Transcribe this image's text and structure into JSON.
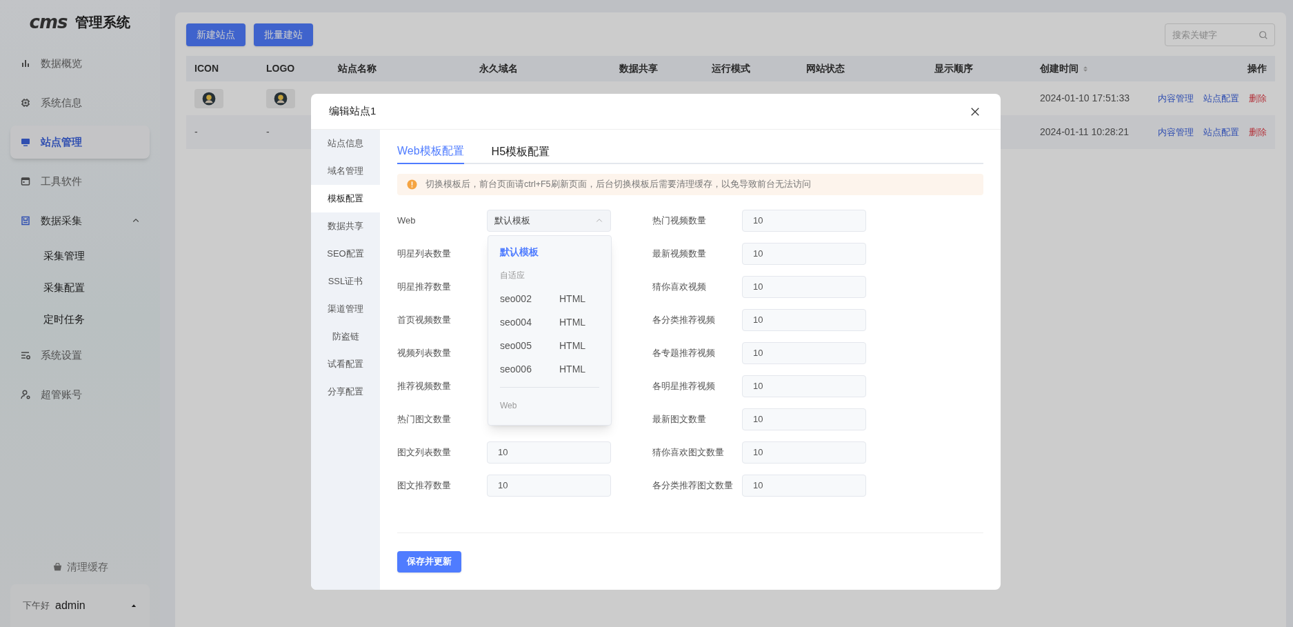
{
  "sidebar": {
    "logo": "cms",
    "title": "管理系统",
    "items": [
      {
        "label": "数据概览",
        "selected": false
      },
      {
        "label": "系统信息",
        "selected": false
      },
      {
        "label": "站点管理",
        "selected": true
      },
      {
        "label": "工具软件",
        "selected": false
      },
      {
        "label": "数据采集",
        "selected": false,
        "expanded": true,
        "children": [
          {
            "label": "采集管理",
            "selected": false
          },
          {
            "label": "采集配置",
            "selected": false
          },
          {
            "label": "定时任务",
            "selected": false
          }
        ]
      },
      {
        "label": "系统设置",
        "selected": false
      },
      {
        "label": "超管账号",
        "selected": false
      }
    ],
    "clear_cache": "清理缓存",
    "user": {
      "greeting": "下午好",
      "name": "admin"
    }
  },
  "toolbar": {
    "buttons": [
      "新建站点",
      "批量建站"
    ],
    "search": {
      "placeholder": "搜索关键字"
    }
  },
  "table": {
    "columns": [
      {
        "label": "ICON"
      },
      {
        "label": "LOGO"
      },
      {
        "label": "站点名称"
      },
      {
        "label": "永久域名"
      },
      {
        "label": "数据共享"
      },
      {
        "label": "运行模式"
      },
      {
        "label": "网站状态"
      },
      {
        "label": "显示顺序"
      },
      {
        "label": "创建时间",
        "sortable": true
      },
      {
        "label": "操作"
      }
    ],
    "rows": [
      {
        "icon": {
          "kind": "avatar"
        },
        "logo": {
          "kind": "avatar"
        },
        "created": "2024-01-10 17:51:33",
        "actions": [
          {
            "label": "内容管理",
            "kind": "link"
          },
          {
            "label": "站点配置",
            "kind": "link"
          },
          {
            "label": "删除",
            "kind": "danger"
          }
        ]
      },
      {
        "icon": {
          "kind": "text",
          "text": "-"
        },
        "logo": {
          "kind": "text",
          "text": "-"
        },
        "created": "2024-01-11 10:28:21",
        "actions": [
          {
            "label": "内容管理",
            "kind": "link"
          },
          {
            "label": "站点配置",
            "kind": "link"
          },
          {
            "label": "删除",
            "kind": "danger"
          }
        ]
      }
    ]
  },
  "modal": {
    "title": "编辑站点1",
    "nav": [
      {
        "label": "站点信息",
        "selected": false
      },
      {
        "label": "域名管理",
        "selected": false
      },
      {
        "label": "模板配置",
        "selected": true
      },
      {
        "label": "数据共享",
        "selected": false
      },
      {
        "label": "SEO配置",
        "selected": false
      },
      {
        "label": "SSL证书",
        "selected": false
      },
      {
        "label": "渠道管理",
        "selected": false
      },
      {
        "label": "防盗链",
        "selected": false
      },
      {
        "label": "试看配置",
        "selected": false
      },
      {
        "label": "分享配置",
        "selected": false
      }
    ],
    "tabs": [
      {
        "label": "Web模板配置",
        "selected": true
      },
      {
        "label": "H5模板配置",
        "selected": false
      }
    ],
    "alert": "切换模板后，前台页面请ctrl+F5刷新页面，后台切换模板后需要清理缓存，以免导致前台无法访问",
    "web_select": {
      "label": "Web",
      "value": "默认模板",
      "open": true
    },
    "dropdown": [
      {
        "kind": "option",
        "name": "默认模板",
        "selected": true
      },
      {
        "kind": "group",
        "label": "自适应"
      },
      {
        "kind": "option",
        "name": "seo002",
        "type": "HTML",
        "selected": false
      },
      {
        "kind": "option",
        "name": "seo004",
        "type": "HTML",
        "selected": false
      },
      {
        "kind": "option",
        "name": "seo005",
        "type": "HTML",
        "selected": false
      },
      {
        "kind": "option",
        "name": "seo006",
        "type": "HTML",
        "selected": false
      },
      {
        "kind": "divider"
      },
      {
        "kind": "group",
        "label": "Web"
      }
    ],
    "fields_left": [
      {
        "label": "明星列表数量"
      },
      {
        "label": "明星推荐数量"
      },
      {
        "label": "首页视频数量"
      },
      {
        "label": "视频列表数量"
      },
      {
        "label": "推荐视频数量"
      },
      {
        "label": "热门图文数量"
      },
      {
        "label": "图文列表数量",
        "value": "10"
      },
      {
        "label": "图文推荐数量",
        "value": "10"
      }
    ],
    "fields_right": [
      {
        "label": "热门视频数量",
        "value": "10"
      },
      {
        "label": "最新视频数量",
        "value": "10"
      },
      {
        "label": "猜你喜欢视频",
        "value": "10"
      },
      {
        "label": "各分类推荐视频",
        "value": "10"
      },
      {
        "label": "各专题推荐视频",
        "value": "10"
      },
      {
        "label": "各明星推荐视频",
        "value": "10"
      },
      {
        "label": "最新图文数量",
        "value": "10"
      },
      {
        "label": "猜你喜欢图文数量",
        "value": "10"
      },
      {
        "label": "各分类推荐图文数量",
        "value": "10"
      }
    ],
    "save_button": "保存并更新"
  }
}
